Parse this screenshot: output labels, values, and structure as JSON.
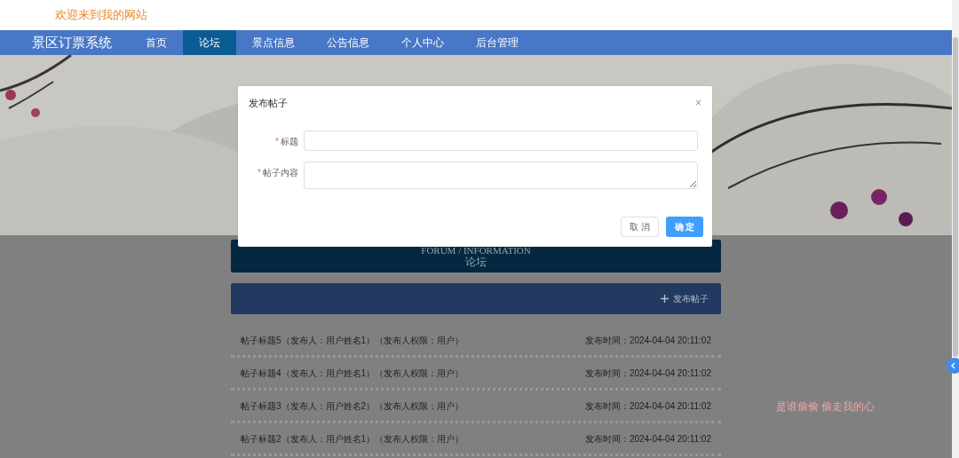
{
  "header": {
    "welcome": "欢迎来到我的网站"
  },
  "nav": {
    "brand": "景区订票系统",
    "items": [
      {
        "label": "首页",
        "selected": false
      },
      {
        "label": "论坛",
        "selected": true
      },
      {
        "label": "景点信息",
        "selected": false
      },
      {
        "label": "公告信息",
        "selected": false
      },
      {
        "label": "个人中心",
        "selected": false
      },
      {
        "label": "后台管理",
        "selected": false
      }
    ]
  },
  "banner": {
    "title_en": "FORUM / INFORMATION",
    "title_zh": "论坛"
  },
  "toolbar": {
    "post_button": "发布帖子"
  },
  "posts": [
    {
      "title": "帖子标题5（发布人：用户姓名1）（发布人权限：用户）",
      "time": "发布时间：2024-04-04 20:11:02"
    },
    {
      "title": "帖子标题4（发布人：用户姓名1）（发布人权限：用户）",
      "time": "发布时间：2024-04-04 20:11:02"
    },
    {
      "title": "帖子标题3（发布人：用户姓名2）（发布人权限：用户）",
      "time": "发布时间：2024-04-04 20:11:02"
    },
    {
      "title": "帖子标题2（发布人：用户姓名1）（发布人权限：用户）",
      "time": "发布时间：2024-04-04 20:11:02"
    }
  ],
  "floating_text": "是谁偷偷 偷走我的心",
  "dialog": {
    "title": "发布帖子",
    "close": "×",
    "required_mark": "*",
    "fields": [
      {
        "label": "标题",
        "required": true,
        "kind": "input"
      },
      {
        "label": "帖子内容",
        "required": true,
        "kind": "textarea"
      }
    ],
    "buttons": [
      {
        "label": "取 消",
        "kind": "default"
      },
      {
        "label": "确 定",
        "kind": "primary"
      }
    ]
  }
}
